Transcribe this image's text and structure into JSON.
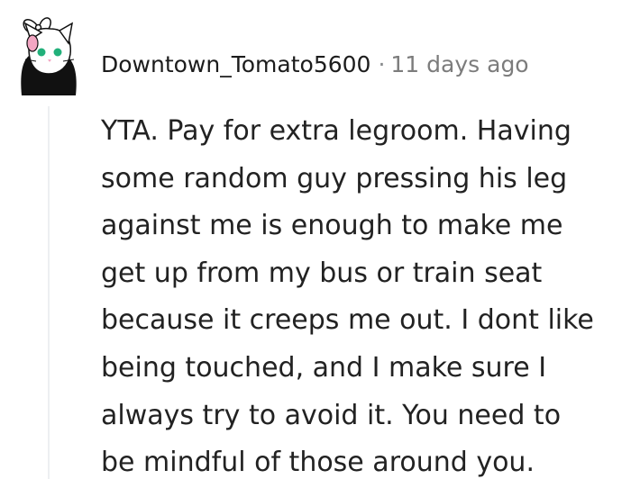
{
  "comment": {
    "username": "Downtown_Tomato5600",
    "separator": "·",
    "timestamp": "11 days ago",
    "body_lines": [
      "YTA. Pay for extra legroom. Having",
      "some random guy pressing his leg",
      "against me is enough to make me",
      "get up from my bus or train seat",
      "because it creeps me out. I dont like",
      "being touched, and I make sure I",
      "always try to avoid it. You need to",
      "be mindful of those around you."
    ]
  }
}
